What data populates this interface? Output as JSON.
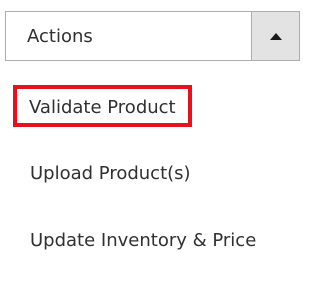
{
  "dropdown": {
    "label": "Actions",
    "toggle_icon": "caret-up-icon"
  },
  "menu": {
    "items": [
      {
        "label": "Validate Product",
        "highlighted": true,
        "highlight_color": "#e8101c"
      },
      {
        "label": "Upload Product(s)"
      },
      {
        "label": "Update Inventory & Price"
      }
    ]
  }
}
